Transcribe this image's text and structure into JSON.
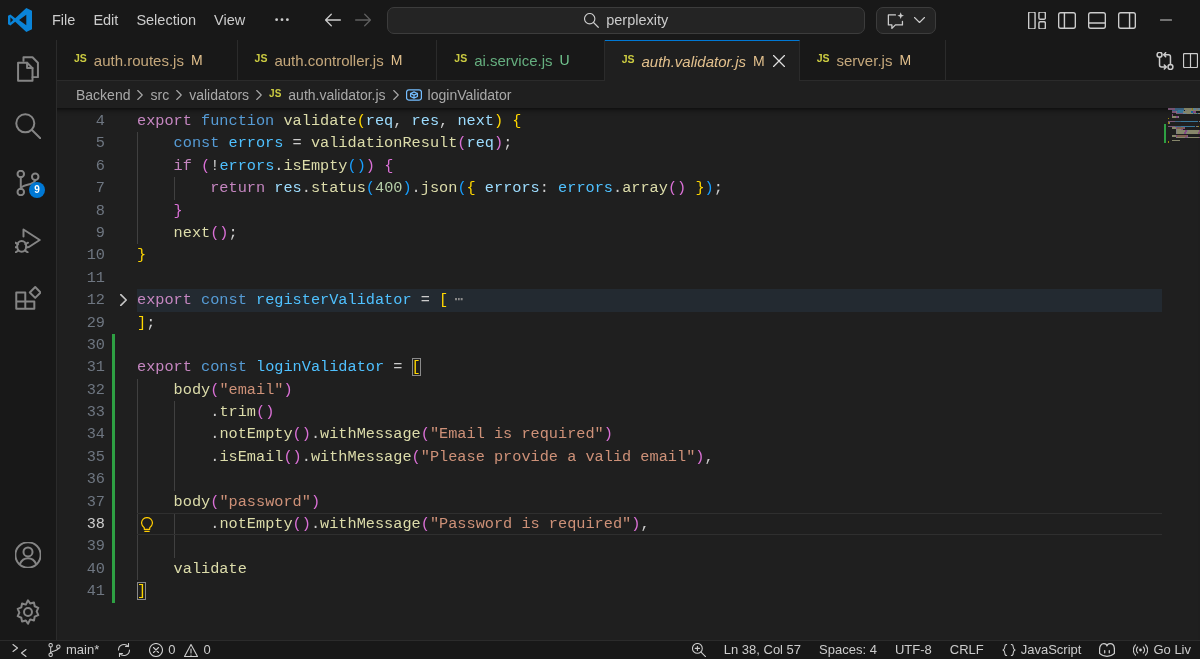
{
  "title_bar": {
    "menu": [
      "File",
      "Edit",
      "Selection",
      "View"
    ],
    "navigation": [
      {
        "kind": "back",
        "disabled": false
      },
      {
        "kind": "forward",
        "disabled": true
      }
    ],
    "command_center": {
      "label": "perplexity"
    }
  },
  "activity_bar": {
    "items": [
      {
        "kind": "explorer",
        "selected": false
      },
      {
        "kind": "search",
        "selected": false
      },
      {
        "kind": "source-control",
        "selected": false,
        "badge": "9"
      },
      {
        "kind": "run-debug",
        "selected": false
      },
      {
        "kind": "extensions",
        "selected": false
      }
    ],
    "bottom_items": [
      {
        "kind": "account"
      },
      {
        "kind": "settings"
      }
    ]
  },
  "tabs": [
    {
      "icon": "JS",
      "label": "auth.routes.js",
      "git": "M",
      "color": "#e2c08d",
      "selected": false,
      "preview": false
    },
    {
      "icon": "JS",
      "label": "auth.controller.js",
      "git": "M",
      "color": "#e2c08d",
      "selected": false,
      "preview": false
    },
    {
      "icon": "JS",
      "label": "ai.service.js",
      "git": "U",
      "color": "#73c991",
      "selected": false,
      "preview": false
    },
    {
      "icon": "JS",
      "label": "auth.validator.js",
      "git": "M",
      "color": "#e2c08d",
      "selected": true,
      "preview": true
    },
    {
      "icon": "JS",
      "label": "server.js",
      "git": "M",
      "color": "#e2c08d",
      "selected": false,
      "preview": false
    }
  ],
  "breadcrumb": [
    {
      "kind": "folder",
      "label": "Backend"
    },
    {
      "kind": "folder",
      "label": "src"
    },
    {
      "kind": "folder",
      "label": "validators"
    },
    {
      "kind": "file",
      "icon": "JS",
      "label": "auth.validator.js"
    },
    {
      "kind": "symbol",
      "label": "loginValidator"
    }
  ],
  "editor": {
    "lines": [
      {
        "number": "4",
        "current": false,
        "added": false,
        "tokens": [
          {
            "text": "export ",
            "kind": "keyword"
          },
          {
            "text": "function ",
            "kind": "storage"
          },
          {
            "text": "validate",
            "kind": "function"
          },
          {
            "text": "(",
            "kind": "bracket1"
          },
          {
            "text": "req",
            "kind": "param"
          },
          {
            "text": ", ",
            "kind": "plain"
          },
          {
            "text": "res",
            "kind": "param"
          },
          {
            "text": ", ",
            "kind": "plain"
          },
          {
            "text": "next",
            "kind": "param"
          },
          {
            "text": ") {",
            "kind": "bracket1"
          }
        ]
      },
      {
        "number": "5",
        "current": false,
        "added": false,
        "tokens": [
          {
            "text": "    const ",
            "kind": "storage"
          },
          {
            "text": "errors",
            "kind": "constant"
          },
          {
            "text": " = ",
            "kind": "plain"
          },
          {
            "text": "validationResult",
            "kind": "function"
          },
          {
            "text": "(",
            "kind": "bracket2"
          },
          {
            "text": "req",
            "kind": "param"
          },
          {
            "text": ")",
            "kind": "bracket2"
          },
          {
            "text": ";",
            "kind": "plain"
          }
        ]
      },
      {
        "number": "6",
        "current": false,
        "added": false,
        "tokens": [
          {
            "text": "    if ",
            "kind": "keyword"
          },
          {
            "text": "(",
            "kind": "bracket2"
          },
          {
            "text": "!",
            "kind": "plain"
          },
          {
            "text": "errors",
            "kind": "constant"
          },
          {
            "text": ".",
            "kind": "plain"
          },
          {
            "text": "isEmpty",
            "kind": "function"
          },
          {
            "text": "()",
            "kind": "bracket3"
          },
          {
            "text": ") {",
            "kind": "bracket2"
          }
        ]
      },
      {
        "number": "7",
        "current": false,
        "added": false,
        "tokens": [
          {
            "text": "        return ",
            "kind": "keyword"
          },
          {
            "text": "res",
            "kind": "param"
          },
          {
            "text": ".",
            "kind": "plain"
          },
          {
            "text": "status",
            "kind": "function"
          },
          {
            "text": "(",
            "kind": "bracket3"
          },
          {
            "text": "400",
            "kind": "number"
          },
          {
            "text": ")",
            "kind": "bracket3"
          },
          {
            "text": ".",
            "kind": "plain"
          },
          {
            "text": "json",
            "kind": "function"
          },
          {
            "text": "(",
            "kind": "bracket3"
          },
          {
            "text": "{ ",
            "kind": "bracket1"
          },
          {
            "text": "errors",
            "kind": "param"
          },
          {
            "text": ": ",
            "kind": "plain"
          },
          {
            "text": "errors",
            "kind": "constant"
          },
          {
            "text": ".",
            "kind": "plain"
          },
          {
            "text": "array",
            "kind": "function"
          },
          {
            "text": "() ",
            "kind": "bracket2"
          },
          {
            "text": "}",
            "kind": "bracket1"
          },
          {
            "text": ")",
            "kind": "bracket3"
          },
          {
            "text": ";",
            "kind": "plain"
          }
        ]
      },
      {
        "number": "8",
        "current": false,
        "added": false,
        "tokens": [
          {
            "text": "    }",
            "kind": "bracket2"
          }
        ]
      },
      {
        "number": "9",
        "current": false,
        "added": false,
        "tokens": [
          {
            "text": "    next",
            "kind": "function"
          },
          {
            "text": "()",
            "kind": "bracket2"
          },
          {
            "text": ";",
            "kind": "plain"
          }
        ]
      },
      {
        "number": "10",
        "current": false,
        "added": false,
        "tokens": [
          {
            "text": "}",
            "kind": "bracket1"
          }
        ]
      },
      {
        "number": "11",
        "current": false,
        "added": false
      },
      {
        "number": "12",
        "current": false,
        "added": false,
        "tokens": [
          {
            "text": "export ",
            "kind": "keyword"
          },
          {
            "text": "const ",
            "kind": "storage"
          },
          {
            "text": "registerValidator",
            "kind": "constant"
          },
          {
            "text": " = ",
            "kind": "plain"
          },
          {
            "text": "[",
            "kind": "bracket1"
          },
          {
            "text": "⋯",
            "kind": "fold-ellipsis"
          }
        ]
      },
      {
        "number": "29",
        "current": false,
        "added": false,
        "tokens": [
          {
            "text": "]",
            "kind": "bracket1"
          },
          {
            "text": ";",
            "kind": "plain"
          }
        ]
      },
      {
        "number": "30",
        "current": false,
        "added": true
      },
      {
        "number": "31",
        "current": false,
        "added": true,
        "tokens": [
          {
            "text": "export ",
            "kind": "keyword"
          },
          {
            "text": "const ",
            "kind": "storage"
          },
          {
            "text": "loginValidator",
            "kind": "constant"
          },
          {
            "text": " = ",
            "kind": "plain"
          },
          {
            "text": "[",
            "kind": "bracket-match"
          }
        ]
      },
      {
        "number": "32",
        "current": false,
        "added": true,
        "tokens": [
          {
            "text": "    body",
            "kind": "function"
          },
          {
            "text": "(",
            "kind": "bracket2"
          },
          {
            "text": "\"email\"",
            "kind": "string"
          },
          {
            "text": ")",
            "kind": "bracket2"
          }
        ]
      },
      {
        "number": "33",
        "current": false,
        "added": true,
        "tokens": [
          {
            "text": "        .",
            "kind": "plain"
          },
          {
            "text": "trim",
            "kind": "function"
          },
          {
            "text": "()",
            "kind": "bracket2"
          }
        ]
      },
      {
        "number": "34",
        "current": false,
        "added": true,
        "tokens": [
          {
            "text": "        .",
            "kind": "plain"
          },
          {
            "text": "notEmpty",
            "kind": "function"
          },
          {
            "text": "()",
            "kind": "bracket2"
          },
          {
            "text": ".",
            "kind": "plain"
          },
          {
            "text": "withMessage",
            "kind": "function"
          },
          {
            "text": "(",
            "kind": "bracket2"
          },
          {
            "text": "\"Email is required\"",
            "kind": "string"
          },
          {
            "text": ")",
            "kind": "bracket2"
          }
        ]
      },
      {
        "number": "35",
        "current": false,
        "added": true,
        "tokens": [
          {
            "text": "        .",
            "kind": "plain"
          },
          {
            "text": "isEmail",
            "kind": "function"
          },
          {
            "text": "()",
            "kind": "bracket2"
          },
          {
            "text": ".",
            "kind": "plain"
          },
          {
            "text": "withMessage",
            "kind": "function"
          },
          {
            "text": "(",
            "kind": "bracket2"
          },
          {
            "text": "\"Please provide a valid email\"",
            "kind": "string"
          },
          {
            "text": ")",
            "kind": "bracket2"
          },
          {
            "text": ",",
            "kind": "plain"
          }
        ]
      },
      {
        "number": "36",
        "current": false,
        "added": true
      },
      {
        "number": "37",
        "current": false,
        "added": true,
        "tokens": [
          {
            "text": "    body",
            "kind": "function"
          },
          {
            "text": "(",
            "kind": "bracket2"
          },
          {
            "text": "\"password\"",
            "kind": "string"
          },
          {
            "text": ")",
            "kind": "bracket2"
          }
        ]
      },
      {
        "number": "38",
        "current": true,
        "added": true,
        "tokens": [
          {
            "text": "        .",
            "kind": "plain"
          },
          {
            "text": "notEmpty",
            "kind": "function"
          },
          {
            "text": "()",
            "kind": "bracket2"
          },
          {
            "text": ".",
            "kind": "plain"
          },
          {
            "text": "withMessage",
            "kind": "function"
          },
          {
            "text": "(",
            "kind": "bracket2"
          },
          {
            "text": "\"Password is required\"",
            "kind": "string"
          },
          {
            "text": ")",
            "kind": "bracket2"
          },
          {
            "text": ",",
            "kind": "plain"
          }
        ]
      },
      {
        "number": "39",
        "current": false,
        "added": true
      },
      {
        "number": "40",
        "current": false,
        "added": true,
        "tokens": [
          {
            "text": "    validate",
            "kind": "function"
          }
        ]
      },
      {
        "number": "41",
        "current": false,
        "added": true,
        "tokens": [
          {
            "text": "]",
            "kind": "bracket-match"
          }
        ]
      }
    ]
  },
  "status_bar": {
    "left": [
      {
        "kind": "remote"
      },
      {
        "kind": "branch",
        "label": "main*"
      },
      {
        "kind": "sync"
      },
      {
        "kind": "problems",
        "errors": "0",
        "warnings": "0"
      }
    ],
    "right": [
      {
        "kind": "zoom"
      },
      {
        "kind": "text",
        "label": "Ln 38, Col 57"
      },
      {
        "kind": "text",
        "label": "Spaces: 4"
      },
      {
        "kind": "text",
        "label": "UTF-8"
      },
      {
        "kind": "text",
        "label": "CRLF"
      },
      {
        "kind": "language",
        "label": "JavaScript"
      },
      {
        "kind": "assistant"
      },
      {
        "kind": "live-server",
        "label": "Go Liv"
      }
    ]
  }
}
